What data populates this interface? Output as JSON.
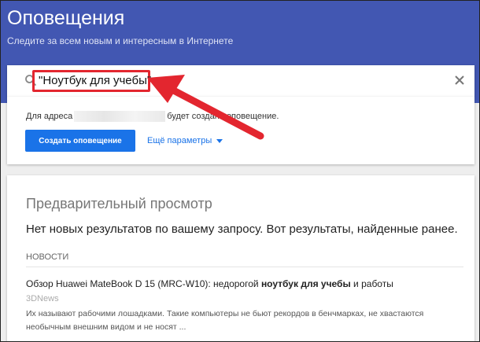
{
  "header": {
    "title": "Оповещения",
    "subtitle": "Следите за всем новым и интересным в Интернете"
  },
  "search": {
    "query": "\"Ноутбук для учебы\""
  },
  "create_card": {
    "addr_prefix": "Для адреса",
    "addr_suffix": "будет создано оповещение.",
    "create_button": "Создать оповещение",
    "more_options": "Ещё параметры"
  },
  "preview": {
    "title": "Предварительный просмотр",
    "no_results": "Нет новых результатов по вашему запросу. Вот результаты, найденные ранее.",
    "section": "НОВОСТИ",
    "item": {
      "title_pre": "Обзор Huawei MateBook D 15 (MRC-W10): недорогой ",
      "title_bold": "ноутбук для учебы",
      "title_post": " и работы",
      "source": "3DNews",
      "snippet": "Их называют рабочими лошадками. Такие компьютеры не бьют рекордов в бенчмарках, не хвастаются необычным внешним видом и не носят ..."
    }
  },
  "colors": {
    "header_bg": "#4257b2",
    "accent": "#1a73e8",
    "highlight": "#e3262f"
  },
  "icons": [
    "search-icon",
    "close-icon",
    "caret-down-icon",
    "arrow-annotation-icon"
  ]
}
